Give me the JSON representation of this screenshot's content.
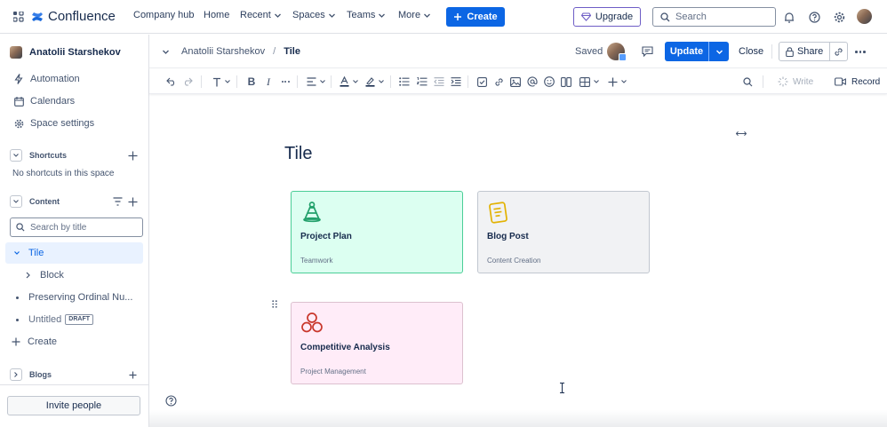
{
  "app": {
    "name": "Confluence"
  },
  "topnav": {
    "items": [
      {
        "label": "Company hub"
      },
      {
        "label": "Home"
      },
      {
        "label": "Recent"
      },
      {
        "label": "Spaces"
      },
      {
        "label": "Teams"
      },
      {
        "label": "More"
      }
    ],
    "create_label": "Create",
    "upgrade_label": "Upgrade",
    "search_placeholder": "Search"
  },
  "sidebar": {
    "space_name": "Anatolii Starshekov",
    "items": [
      {
        "label": "Automation",
        "icon": "lightning-icon"
      },
      {
        "label": "Calendars",
        "icon": "calendar-icon"
      },
      {
        "label": "Space settings",
        "icon": "gear-icon"
      }
    ],
    "shortcuts": {
      "label": "Shortcuts",
      "empty_text": "No shortcuts in this space"
    },
    "content": {
      "label": "Content",
      "search_placeholder": "Search by title"
    },
    "tree": [
      {
        "label": "Tile",
        "selected": true
      },
      {
        "label": "Block"
      },
      {
        "label": "Preserving Ordinal Nu..."
      },
      {
        "label": "Untitled",
        "badge": "DRAFT"
      }
    ],
    "create_label": "Create",
    "blogs_label": "Blogs",
    "invite_label": "Invite people"
  },
  "pagebar": {
    "breadcrumb": {
      "parent": "Anatolii Starshekov",
      "current": "Tile"
    },
    "saved_label": "Saved",
    "update_label": "Update",
    "close_label": "Close",
    "share_label": "Share"
  },
  "toolbar": {
    "write_label": "Write",
    "record_label": "Record"
  },
  "page": {
    "title": "Tile",
    "cards": [
      {
        "title": "Project Plan",
        "subtitle": "Teamwork",
        "bg": "#dcfff1",
        "border": "#4bce97",
        "icon": "cone-icon",
        "icon_color": "#22a06b"
      },
      {
        "title": "Blog Post",
        "subtitle": "Content Creation",
        "bg": "#f1f2f4",
        "border": "#c1c7d0",
        "icon": "document-icon",
        "icon_color": "#e2b203"
      },
      {
        "title": "Competitive Analysis",
        "subtitle": "Project Management",
        "bg": "#ffecf8",
        "border": "#dcc1cf",
        "icon": "circles-icon",
        "icon_color": "#c9372c"
      }
    ]
  },
  "colors": {
    "accent": "#0c66e4",
    "selected_bg": "#e9f2ff",
    "text": "#172b4d",
    "subtle": "#44546f"
  }
}
